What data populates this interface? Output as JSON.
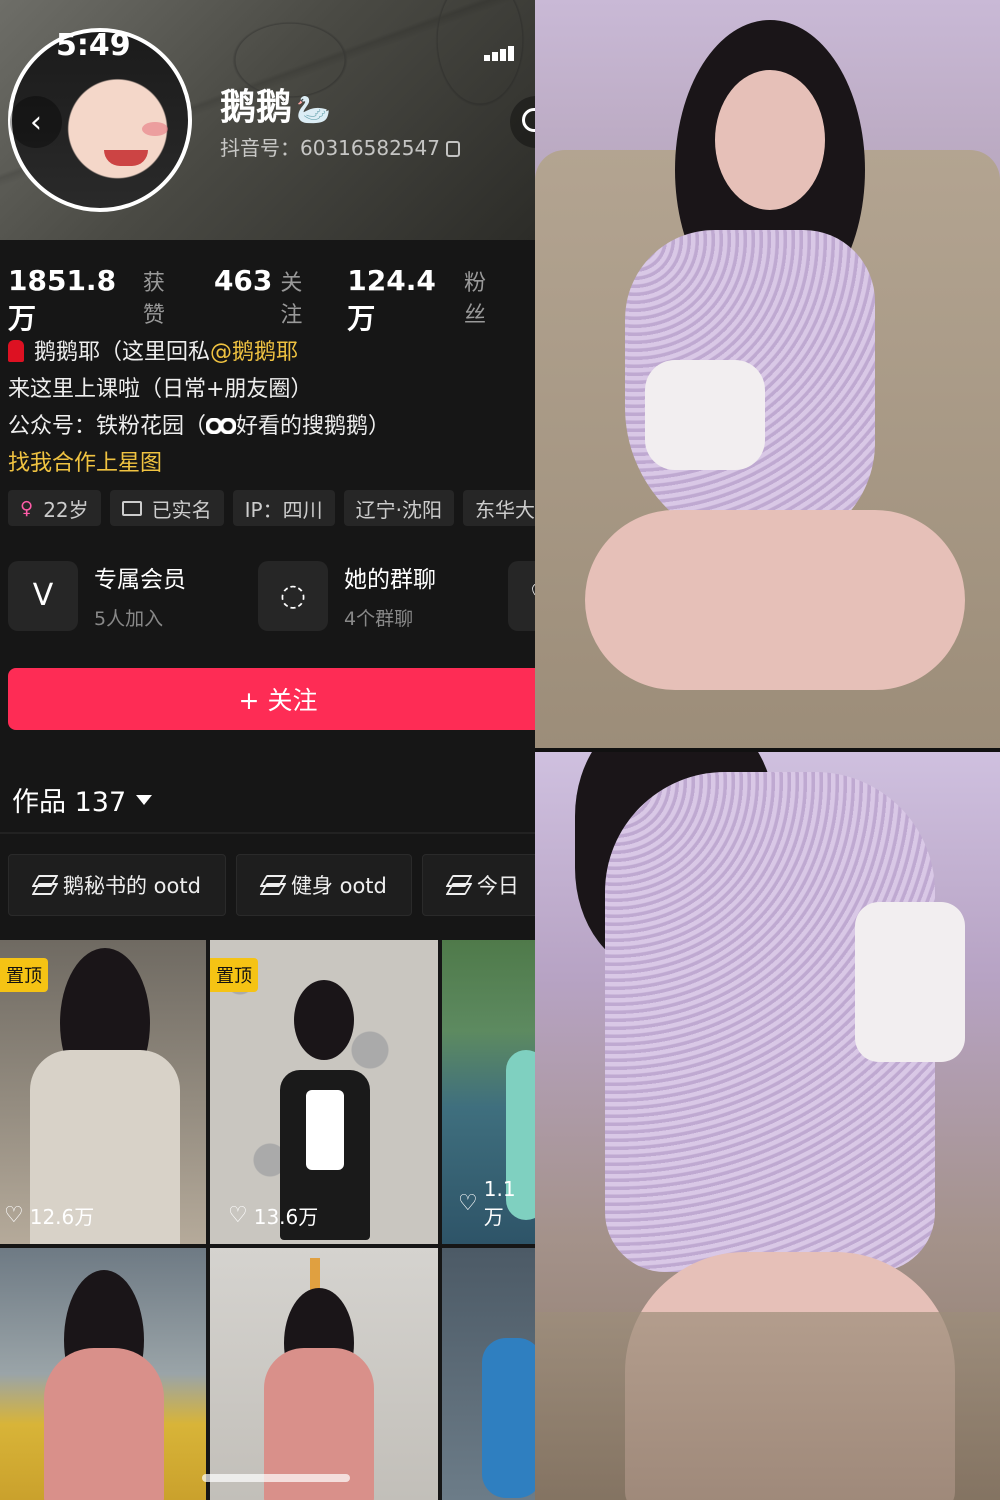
{
  "status_bar": {
    "time": "5:49"
  },
  "profile": {
    "nickname": "鹅鹅",
    "nickname_emoji": "🦢",
    "douyin_id": "抖音号：60316582547"
  },
  "stats": [
    {
      "num": "1851.8万",
      "label": "获赞"
    },
    {
      "num": "463",
      "label": "关注"
    },
    {
      "num": "124.4万",
      "label": "粉丝"
    }
  ],
  "bio": {
    "line1_prefix": "鹅鹅耶（这里回私",
    "line1_mention": "@鹅鹅耶",
    "line2": "来这里上课啦（日常+朋友圈）",
    "line3_prefix": "公众号：铁粉花园（",
    "line3_suffix": "好看的搜鹅鹅）",
    "collab": "找我合作上星图"
  },
  "tags": {
    "age": "22岁",
    "verified": "已实名",
    "ip": "IP：四川",
    "location": "辽宁·沈阳",
    "extra": "东华大"
  },
  "features": [
    {
      "title": "专属会员",
      "sub": "5人加入",
      "icon": "vip-v-icon"
    },
    {
      "title": "她的群聊",
      "sub": "4个群聊",
      "icon": "chat-bubbles-icon"
    }
  ],
  "follow_button": "+ 关注",
  "works": {
    "label": "作品 137"
  },
  "collections": [
    "鹅秘书的 ootd",
    "健身 ootd",
    "今日"
  ],
  "videos": [
    {
      "pinned": "置顶",
      "likes": "12.6万"
    },
    {
      "pinned": "置顶",
      "likes": "13.6万"
    },
    {
      "pinned": "",
      "likes": "1.1万"
    }
  ],
  "colors": {
    "accent_red": "#fe2c55",
    "mention_yellow": "#f0c341",
    "pin_yellow": "#f5c314",
    "background": "#161616"
  }
}
